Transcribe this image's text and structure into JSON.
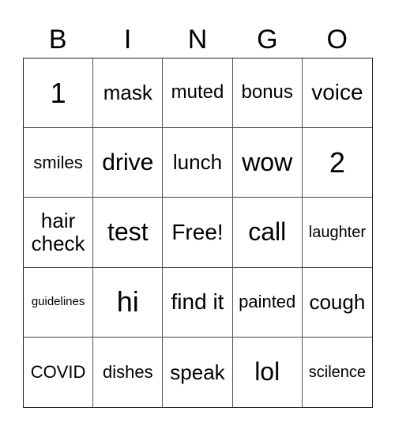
{
  "header": [
    "B",
    "I",
    "N",
    "G",
    "O"
  ],
  "cells": [
    [
      "1",
      "mask",
      "muted",
      "bonus",
      "voice"
    ],
    [
      "smiles",
      "drive",
      "lunch",
      "wow",
      "2"
    ],
    [
      "hair check",
      "test",
      "Free!",
      "call",
      "laughter"
    ],
    [
      "guidelines",
      "hi",
      "find it",
      "painted",
      "cough"
    ],
    [
      "COVID",
      "dishes",
      "speak",
      "lol",
      "scilence"
    ]
  ]
}
